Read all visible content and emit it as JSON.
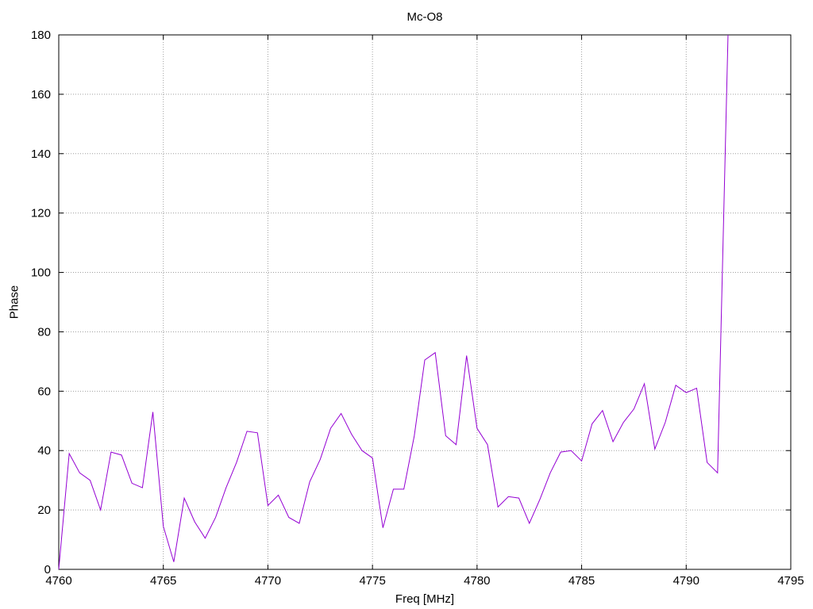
{
  "chart_data": {
    "type": "line",
    "title": "Mc-O8",
    "xlabel": "Freq [MHz]",
    "ylabel": "Phase",
    "xlim": [
      4760,
      4795
    ],
    "ylim": [
      0,
      180
    ],
    "xticks": [
      4760,
      4765,
      4770,
      4775,
      4780,
      4785,
      4790,
      4795
    ],
    "yticks": [
      0,
      20,
      40,
      60,
      80,
      100,
      120,
      140,
      160,
      180
    ],
    "grid": true,
    "series_color": "#9400d3",
    "series": [
      {
        "x": [
          4760,
          4760.5,
          4761,
          4761.5,
          4762,
          4762.5,
          4763,
          4763.5,
          4764,
          4764.5,
          4765,
          4765.5,
          4766,
          4766.5,
          4767,
          4767.5,
          4768,
          4768.5,
          4769,
          4769.5,
          4770,
          4770.5,
          4771,
          4771.5,
          4772,
          4772.5,
          4773,
          4773.5,
          4774,
          4774.5,
          4775,
          4775.5,
          4776,
          4776.5,
          4777,
          4777.5,
          4778,
          4778.5,
          4779,
          4779.5,
          4780,
          4780.5,
          4781,
          4781.5,
          4782,
          4782.5,
          4783,
          4783.5,
          4784,
          4784.5,
          4785,
          4785.5,
          4786,
          4786.5,
          4787,
          4787.5,
          4788,
          4788.5,
          4789,
          4789.5,
          4790,
          4790.5,
          4791,
          4791.5,
          4792
        ],
        "y": [
          0,
          39,
          32.5,
          30,
          20,
          39.5,
          38.5,
          29,
          27.5,
          53,
          14.5,
          2.5,
          24,
          16,
          10.5,
          17.5,
          27.5,
          36,
          46.5,
          46,
          21.5,
          25,
          17.5,
          15.5,
          29.5,
          37,
          47.5,
          52.5,
          45.5,
          40,
          37.5,
          14,
          27,
          27,
          45,
          70.5,
          73,
          45,
          42,
          72,
          47.5,
          42,
          21,
          24.5,
          24,
          15.5,
          23.5,
          32.5,
          39.5,
          40,
          36.5,
          49,
          53.5,
          43,
          49.5,
          54,
          62.5,
          40.5,
          49.5,
          62,
          59.5,
          61,
          36,
          32.5,
          180
        ]
      }
    ]
  }
}
